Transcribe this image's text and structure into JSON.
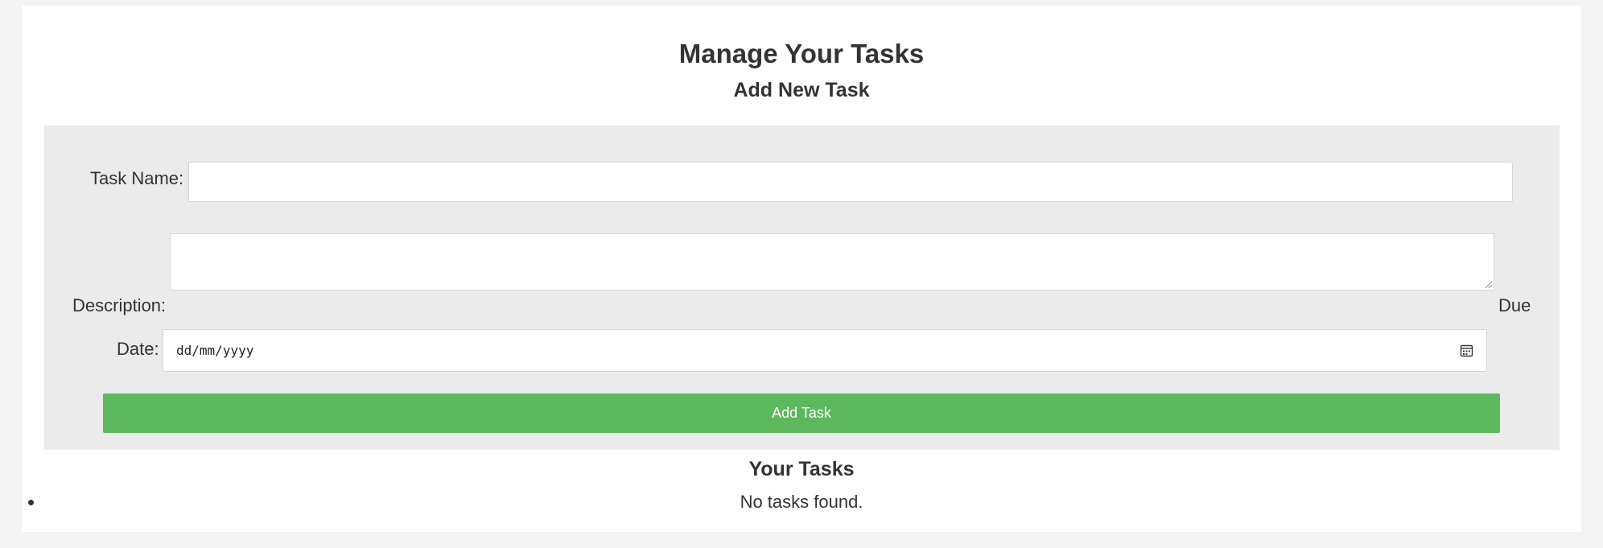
{
  "page": {
    "title": "Manage Your Tasks",
    "add_section_title": "Add New Task"
  },
  "form": {
    "task_name": {
      "label": "Task Name:",
      "value": ""
    },
    "description": {
      "label": "Description:",
      "value": ""
    },
    "due_date": {
      "label_line1": "Due",
      "label_line2": "Date:",
      "placeholder": "dd/mm/yyyy",
      "icon": "calendar-icon"
    },
    "submit_label": "Add Task",
    "button_color": "#5cb85c"
  },
  "tasks": {
    "title": "Your Tasks",
    "items": [
      {
        "text": "No tasks found."
      }
    ]
  }
}
